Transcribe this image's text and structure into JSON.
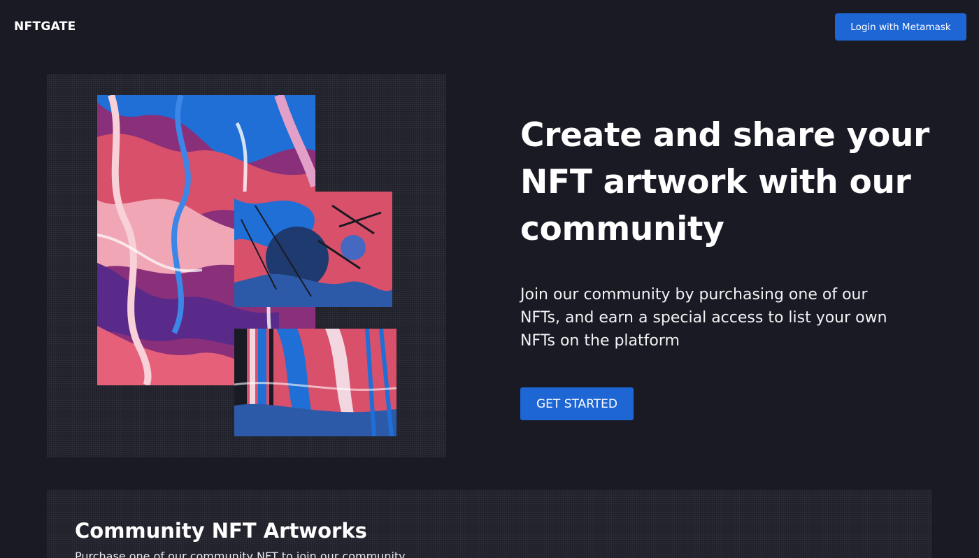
{
  "nav": {
    "logo": "NFTGATE",
    "login_label": "Login with Metamask"
  },
  "hero": {
    "title": "Create and share your NFT artwork with our community",
    "description": "Join our community by purchasing one of our NFTs, and earn a special access to list your own NFTs on the platform",
    "cta_label": "GET STARTED",
    "artworks": [
      "abstract-artwork-image",
      "abstract-artwork-image",
      "abstract-artwork-image"
    ]
  },
  "community": {
    "title": "Community NFT Artworks",
    "subtitle": "Purchase one of our community NFT to join our community"
  },
  "colors": {
    "background": "#1a1a24",
    "accent": "#1e66d4",
    "art_pink": "#d9506a",
    "art_blue": "#1f6fd6",
    "art_purple": "#8a2f7a"
  }
}
